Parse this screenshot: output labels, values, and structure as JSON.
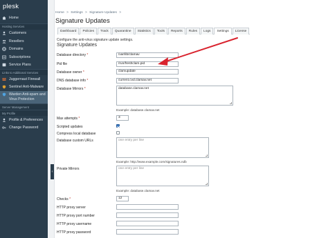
{
  "app": {
    "logo": "plesk"
  },
  "sidebar": {
    "items_top": [
      {
        "label": "Home",
        "icon": "home-icon"
      }
    ],
    "section_hosting": "Hosting Services",
    "hosting_items": [
      {
        "label": "Customers",
        "icon": "users-icon"
      },
      {
        "label": "Resellers",
        "icon": "resellers-icon"
      },
      {
        "label": "Domains",
        "icon": "globe-icon"
      },
      {
        "label": "Subscriptions",
        "icon": "subscriptions-icon"
      },
      {
        "label": "Service Plans",
        "icon": "plans-icon"
      }
    ],
    "section_links": "Links to Additional Services",
    "link_items": [
      {
        "label": "Juggernaut Firewall",
        "icon": "firewall-icon"
      },
      {
        "label": "Sentinel Anti-Malware",
        "icon": "sentinel-icon"
      },
      {
        "label": "Warden Anti-spam and Virus Protection",
        "icon": "warden-icon"
      }
    ],
    "section_server": "Server Management",
    "section_profile": "My Profile",
    "profile_items": [
      {
        "label": "Profile & Preferences",
        "icon": "profile-icon"
      },
      {
        "label": "Change Password",
        "icon": "key-icon"
      }
    ],
    "collapse_glyph": "‹"
  },
  "breadcrumb": {
    "items": [
      "Home",
      ">",
      "Settings",
      ">",
      "Signature Updates",
      ">"
    ]
  },
  "page": {
    "title": "Signature Updates",
    "description": "Configure the anti-virus signature update settings.",
    "section_title": "Signature Updates"
  },
  "tabs": [
    "Dashboard",
    "Policies",
    "Track",
    "Quarantine",
    "Statistics",
    "Tools",
    "Reports",
    "Rules",
    "Logs",
    "Settings",
    "License"
  ],
  "form": {
    "database_directory": {
      "label": "Database directory",
      "required": "*",
      "value": "/var/lib/clamav"
    },
    "pid_file": {
      "label": "Pid file",
      "value": "/run/freshclam.pid"
    },
    "database_owner": {
      "label": "Database owner",
      "required": "*",
      "value": "clamupdate"
    },
    "dns_database_info": {
      "label": "DNS database info",
      "required": "*",
      "value": "current.cvd.clamav.net"
    },
    "database_mirrors": {
      "label": "Database Mirrors",
      "required": "*",
      "value": "database.clamav.net",
      "hint": "Example: database.clamav.net"
    },
    "max_attempts": {
      "label": "Max attempts",
      "required": "*",
      "value": "3"
    },
    "scripted_updates": {
      "label": "Scripted updates",
      "checked": true
    },
    "compress_local_database": {
      "label": "Compress local database",
      "checked": false
    },
    "database_custom_urls": {
      "label": "Database custom URLs",
      "placeholder": "one entry per line",
      "hint": "Example: http://www.example.com/signatures.ndb"
    },
    "private_mirrors": {
      "label": "Private Mirrors",
      "placeholder": "one entry per line",
      "hint": "Example: database.clamav.net"
    },
    "checks": {
      "label": "Checks",
      "required": "*",
      "value": "12"
    },
    "http_proxy_server": {
      "label": "HTTP proxy server",
      "value": ""
    },
    "http_proxy_port": {
      "label": "HTTP proxy port number",
      "value": ""
    },
    "http_proxy_username": {
      "label": "HTTP proxy username",
      "value": ""
    },
    "http_proxy_password": {
      "label": "HTTP proxy password",
      "value": ""
    }
  },
  "colors": {
    "sidebar": "#2a3d4c",
    "active_nav": "#4a6478",
    "arrow": "#d9232e",
    "required": "#c0392b"
  }
}
